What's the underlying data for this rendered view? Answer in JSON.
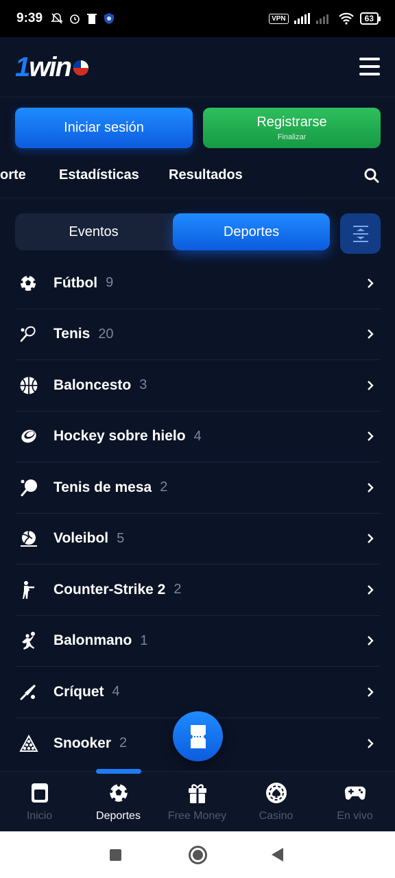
{
  "status_bar": {
    "time": "9:39",
    "vpn": "VPN",
    "battery": "63"
  },
  "header": {
    "logo_one": "1",
    "logo_win": "win"
  },
  "auth": {
    "login_label": "Iniciar sesión",
    "register_label": "Registrarse",
    "register_sub": "Finalizar"
  },
  "nav_tabs": [
    "orte",
    "Estadísticas",
    "Resultados"
  ],
  "segment": {
    "events_label": "Eventos",
    "sports_label": "Deportes",
    "selected": "Deportes"
  },
  "sports": [
    {
      "name": "Fútbol",
      "count": "9",
      "icon": "soccer-ball-icon"
    },
    {
      "name": "Tenis",
      "count": "20",
      "icon": "tennis-racket-icon"
    },
    {
      "name": "Baloncesto",
      "count": "3",
      "icon": "basketball-icon"
    },
    {
      "name": "Hockey sobre hielo",
      "count": "4",
      "icon": "hockey-puck-icon"
    },
    {
      "name": "Tenis de mesa",
      "count": "2",
      "icon": "table-tennis-icon"
    },
    {
      "name": "Voleibol",
      "count": "5",
      "icon": "volleyball-icon"
    },
    {
      "name": "Counter-Strike 2",
      "count": "2",
      "icon": "soldier-icon"
    },
    {
      "name": "Balonmano",
      "count": "1",
      "icon": "handball-icon"
    },
    {
      "name": "Críquet",
      "count": "4",
      "icon": "cricket-bat-icon"
    },
    {
      "name": "Snooker",
      "count": "2",
      "icon": "snooker-triangle-icon"
    }
  ],
  "bottom_nav": [
    {
      "label": "Inicio",
      "icon": "home-icon",
      "active": false
    },
    {
      "label": "Deportes",
      "icon": "soccer-ball-icon",
      "active": true
    },
    {
      "label": "Free Money",
      "icon": "gift-icon",
      "active": false
    },
    {
      "label": "Casino",
      "icon": "casino-chip-icon",
      "active": false
    },
    {
      "label": "En vivo",
      "icon": "gamepad-icon",
      "active": false
    }
  ],
  "colors": {
    "background": "#0b1326",
    "accent_blue": "#1e7cf5",
    "accent_green": "#22ad50",
    "muted_text": "#7a869e"
  }
}
